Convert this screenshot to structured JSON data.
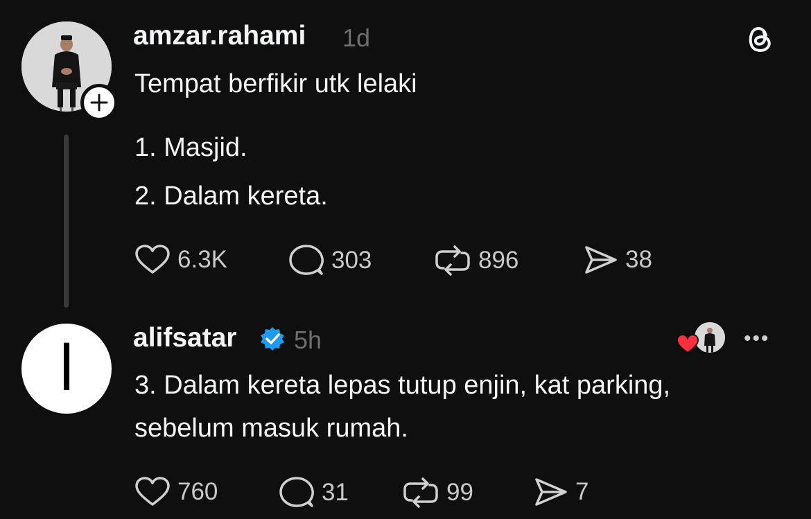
{
  "post": {
    "username": "amzar.rahami",
    "time": "1d",
    "lines": [
      "Tempat berfikir utk lelaki",
      "1. Masjid.",
      "2. Dalam kereta."
    ],
    "actions": {
      "likes": "6.3K",
      "replies": "303",
      "reposts": "896",
      "shares": "38"
    }
  },
  "reply": {
    "username": "alifsatar",
    "verified": true,
    "time": "5h",
    "avatar_glyph": "ا",
    "lines": [
      "3. Dalam kereta lepas tutup enjin, kat parking,",
      "sebelum masuk rumah."
    ],
    "actions": {
      "likes": "760",
      "replies": "31",
      "reposts": "99",
      "shares": "7"
    },
    "more_label": "•••"
  },
  "icons": {
    "app": "threads-icon",
    "follow": "plus-icon",
    "like": "heart-icon",
    "reply": "comment-icon",
    "repost": "repost-icon",
    "share": "send-icon",
    "verified": "verified-badge-icon",
    "liked_by": "heart-liked-icon"
  },
  "colors": {
    "background": "#0f0f0f",
    "text": "#f3f5f7",
    "muted": "#6e6e6e",
    "verified": "#1d9bf0",
    "like_red": "#ff3040"
  }
}
